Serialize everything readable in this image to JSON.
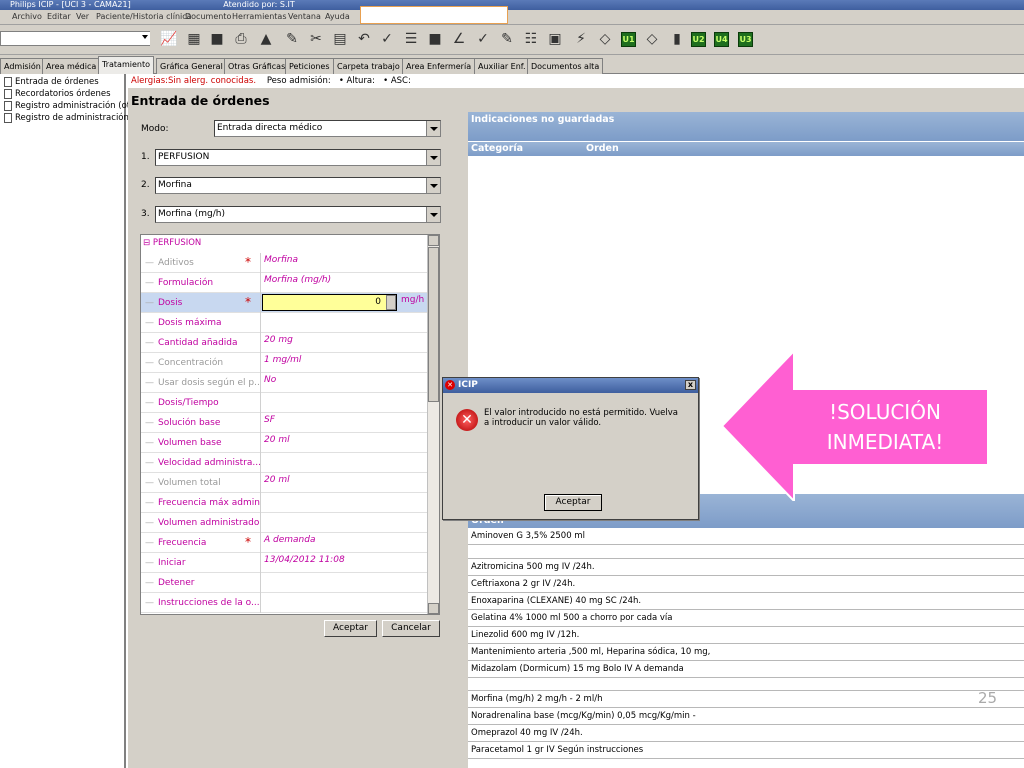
{
  "titlebar": {
    "app_title": "Philips ICIP - [UCI 3 - CAMA21]",
    "attended": "Atendido por: S.IT"
  },
  "menu": [
    "Archivo",
    "Editar",
    "Ver",
    "Paciente/Historia clínica",
    "Documento",
    "Herramientas",
    "Ventana",
    "Ayuda"
  ],
  "toolbar": {
    "combo_value": "",
    "green_buttons": [
      "U1",
      "U2",
      "U4",
      "U3"
    ]
  },
  "tabs": [
    "Admisión",
    "Area médica",
    "Tratamiento",
    "Gráfica General",
    "Otras Gráficas",
    "Peticiones",
    "Carpeta trabajo",
    "Area Enfermería",
    "Auxiliar Enf.",
    "Documentos alta"
  ],
  "tree": [
    "Entrada de órdenes",
    "Recordatorios órdenes",
    "Registro administración (ot",
    "Registro de administración"
  ],
  "alerts": {
    "allergies": "Alergias:Sin alerg. conocidas.",
    "peso": "Peso admisión:",
    "altura": "• Altura:",
    "asc": "• ASC:"
  },
  "page_title": "Entrada de órdenes",
  "form": {
    "modo_label": "Modo:",
    "modo_value": "Entrada directa médico",
    "n1": "1.",
    "v1": "PERFUSION",
    "n2": "2.",
    "v2": "Morfina",
    "n3": "3.",
    "v3": "Morfina (mg/h)"
  },
  "grid": {
    "group": "PERFUSION",
    "rows": [
      {
        "name": "Aditivos",
        "value": "Morfina",
        "required": "*"
      },
      {
        "name": "Formulación",
        "value": "Morfina (mg/h)",
        "required": ""
      },
      {
        "name": "Dosis",
        "value": "",
        "required": "*"
      },
      {
        "name": "Dosis máxima",
        "value": "",
        "required": ""
      },
      {
        "name": "Cantidad añadida",
        "value": "20 mg",
        "required": ""
      },
      {
        "name": "Concentración",
        "value": "1 mg/ml",
        "required": ""
      },
      {
        "name": "Usar dosis según el p...",
        "value": "No",
        "required": ""
      },
      {
        "name": "Dosis/Tiempo",
        "value": "",
        "required": ""
      },
      {
        "name": "Solución base",
        "value": "SF",
        "required": ""
      },
      {
        "name": "Volumen base",
        "value": "20 ml",
        "required": ""
      },
      {
        "name": "Velocidad administra...",
        "value": "",
        "required": ""
      },
      {
        "name": "Volumen total",
        "value": "20 ml",
        "required": ""
      },
      {
        "name": "Frecuencia máx admin.",
        "value": "",
        "required": ""
      },
      {
        "name": "Volumen administrado",
        "value": "",
        "required": ""
      },
      {
        "name": "Frecuencia",
        "value": "A demanda",
        "required": "*"
      },
      {
        "name": "Iniciar",
        "value": "13/04/2012 11:08",
        "required": ""
      },
      {
        "name": "Detener",
        "value": "",
        "required": ""
      },
      {
        "name": "Instrucciones de la o...",
        "value": "",
        "required": ""
      }
    ],
    "dosis_input": "0",
    "dosis_unit": "mg/h"
  },
  "buttons": {
    "accept": "Aceptar",
    "cancel": "Cancelar"
  },
  "unsaved": {
    "header": "Indicaciones no guardadas",
    "col_category": "Categoría",
    "col_order": "Orden"
  },
  "orders": {
    "header": "Orden",
    "items": [
      "Aminoven G 3,5% 2500 ml",
      "Azitromicina 500 mg IV /24h.",
      "Ceftriaxona 2 gr IV /24h.",
      "Enoxaparina (CLEXANE) 40 mg SC /24h.",
      "Gelatina 4% 1000 ml 500 a chorro por cada vía",
      "Linezolid 600 mg IV /12h.",
      "Mantenimiento arteria ,500 ml, Heparina sódica, 10 mg,",
      "Midazolam (Dormicum) 15 mg Bolo IV A demanda",
      "Morfina (mg/h) 2 mg/h - 2 ml/h",
      "Noradrenalina base (mcg/Kg/min) 0,05 mcg/Kg/min -",
      "Omeprazol 40 mg IV /24h.",
      "Paracetamol 1 gr IV Según instrucciones"
    ]
  },
  "dialog": {
    "title": "ICIP",
    "message": "El valor introducido no está permitido. Vuelva a introducir un valor válido.",
    "ok": "Aceptar",
    "close": "x"
  },
  "callout": {
    "text": "!SOLUCIÓN INMEDIATA!",
    "color": "#ff5fd2"
  },
  "page_number": "25"
}
